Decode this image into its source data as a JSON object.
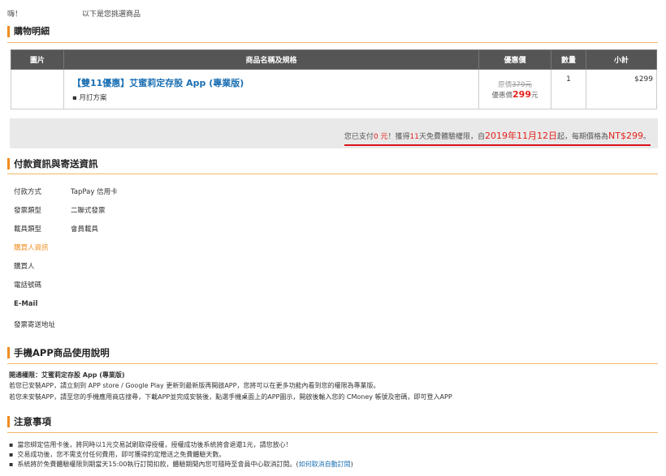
{
  "greeting": {
    "hello": "嗨！",
    "message": "以下是您挑選商品"
  },
  "cart": {
    "title": "購物明細",
    "headers": {
      "image": "圖片",
      "name": "商品名稱及規格",
      "price": "優惠價",
      "qty": "數量",
      "subtotal": "小計"
    },
    "item": {
      "name": "【雙11優惠】艾蜜莉定存股 App (專業版)",
      "plan": "月訂方案",
      "original_label": "原價",
      "original_price": "379元",
      "discount_label": "優惠價",
      "discount_price": "299",
      "discount_unit": "元",
      "qty": "1",
      "subtotal": "$299"
    }
  },
  "payment_note": {
    "part1": "您已支付",
    "paid": "0 元",
    "part2": "！獲得",
    "days": "11",
    "part3": "天免費體驗權限，自",
    "date": "2019年11月12日",
    "part4": "起，每期價格為",
    "price": "NT$299",
    "end": "。"
  },
  "payinfo": {
    "title": "付款資訊與寄送資訊",
    "rows": [
      {
        "label": "付款方式",
        "value": "TapPay 信用卡"
      },
      {
        "label": "發票類型",
        "value": "二聯式發票"
      },
      {
        "label": "載具類型",
        "value": "會員載具"
      },
      {
        "label": "購買人資訊",
        "value": ""
      },
      {
        "label": "購買人",
        "value": ""
      },
      {
        "label": "電話號碼",
        "value": ""
      },
      {
        "label": "E-Mail",
        "value": ""
      },
      {
        "label": "發票寄送地址",
        "value": ""
      }
    ]
  },
  "app_guide": {
    "title": "手機APP商品使用說明",
    "line1": "開通權限：艾蜜莉定存股 App (專業版)",
    "line2": "若您已安裝APP，請立刻到 APP store / Google Play 更新到最新版再開啟APP，您將可以在更多功能內看到您的權限為專業版。",
    "line3": "若您未安裝APP，請至您的手機應用商店搜尋，下載APP並完成安裝後，點選手機桌面上的APP圖示，開啟後輸入您的 CMoney 帳號及密碼，即可登入APP"
  },
  "notices": {
    "title": "注意事項",
    "items": [
      "當您綁定信用卡後，將同時以1元交易試刷取得授權，授權成功後系統將會退還1元，請您放心！",
      "交易成功後，您不需支付任何費用，即可獲得約定贈送之免費體驗天數。",
      "系統將於免費體驗權限到期當天15:00執行訂閱扣款，體驗期間內您可隨時至會員中心取消訂閱。("
    ],
    "link": "如何取消自動訂閱",
    "link_end": ")"
  },
  "colors": {
    "accent": "#f08c1e",
    "header_bg": "#555555",
    "price_red": "#e4211c",
    "link_blue": "#1a6fb3",
    "note_bar": "#e9e9e9"
  }
}
